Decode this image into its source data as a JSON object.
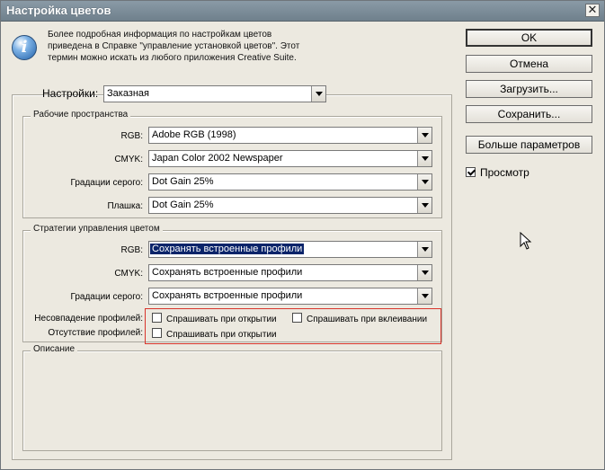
{
  "window": {
    "title": "Настройка цветов",
    "close_label": "✕"
  },
  "info": {
    "icon": "info-icon",
    "icon_glyph": "i",
    "line1": "Более подробная информация по настройкам цветов",
    "line2": "приведена в Справке \"управление установкой цветов\". Этот",
    "line3": "термин можно искать из любого приложения Creative Suite."
  },
  "buttons": {
    "ok": "OK",
    "cancel": "Отмена",
    "load": "Загрузить...",
    "save": "Сохранить...",
    "more": "Больше параметров"
  },
  "preview": {
    "label": "Просмотр",
    "checked": true
  },
  "settings": {
    "label": "Настройки:",
    "value": "Заказная"
  },
  "workspaces": {
    "title": "Рабочие пространства",
    "rgb_label": "RGB:",
    "rgb_value": "Adobe RGB (1998)",
    "cmyk_label": "CMYK:",
    "cmyk_value": "Japan Color 2002 Newspaper",
    "gray_label": "Градации серого:",
    "gray_value": "Dot Gain 25%",
    "spot_label": "Плашка:",
    "spot_value": "Dot Gain 25%"
  },
  "policies": {
    "title": "Стратегии управления цветом",
    "rgb_label": "RGB:",
    "rgb_value": "Сохранять встроенные профили",
    "cmyk_label": "CMYK:",
    "cmyk_value": "Сохранять встроенные профили",
    "gray_label": "Градации серого:",
    "gray_value": "Сохранять встроенные профили",
    "mismatch_label": "Несовпадение профилей:",
    "mismatch_open": "Спрашивать при открытии",
    "mismatch_paste": "Спрашивать при вклеивании",
    "missing_label": "Отсутствие профилей:",
    "missing_open": "Спрашивать при открытии"
  },
  "description": {
    "title": "Описание"
  },
  "colors": {
    "titlebar": "#7a8b97",
    "dialog_bg": "#ece9e0",
    "selection": "#0a246a",
    "highlight_border": "#d9342b"
  }
}
